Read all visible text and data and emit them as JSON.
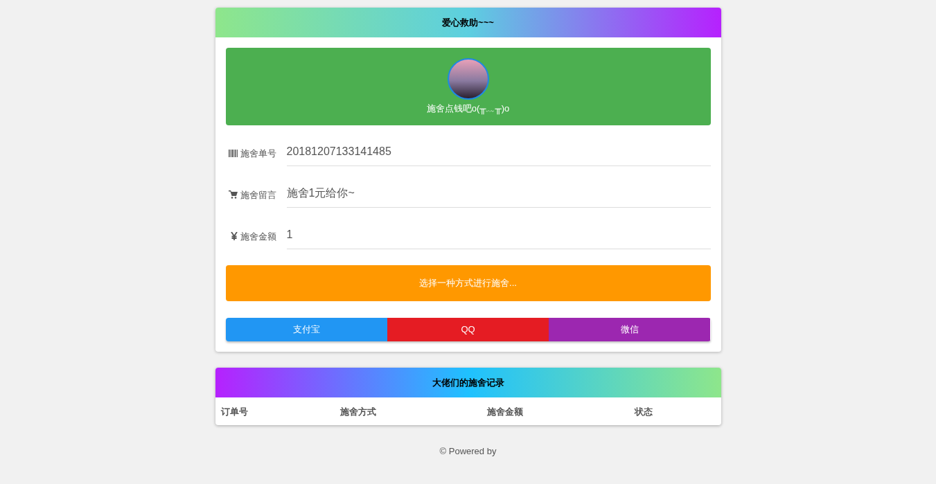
{
  "donate_card": {
    "title": "爱心救助~~~",
    "banner": {
      "caption": "施舍点钱吧o(╥﹏╥)o"
    },
    "fields": [
      {
        "kind": "barcode",
        "label": "施舍单号",
        "value": "20181207133141485"
      },
      {
        "kind": "cart",
        "label": "施舍留言",
        "value": "施舍1元给你~"
      },
      {
        "kind": "yen",
        "label": "施舍金额",
        "value": "1"
      }
    ],
    "prompt": "选择一种方式进行施舍...",
    "payment_buttons": [
      {
        "label": "支付宝",
        "color": "#2196f3"
      },
      {
        "label": "QQ",
        "color": "#e51c23"
      },
      {
        "label": "微信",
        "color": "#9c27b0"
      }
    ]
  },
  "records_card": {
    "title": "大佬们的施舍记录",
    "columns": [
      "订单号",
      "施舍方式",
      "施舍金额",
      "状态"
    ]
  },
  "footer": "© Powered by"
}
